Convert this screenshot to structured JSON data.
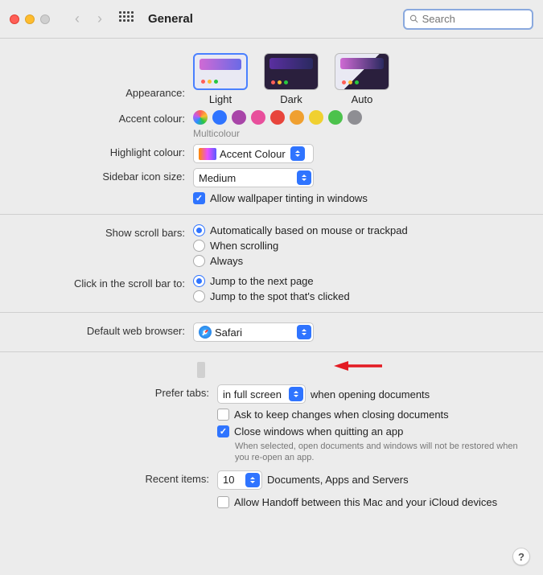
{
  "window": {
    "title": "General"
  },
  "search": {
    "placeholder": "Search"
  },
  "appearance": {
    "label": "Appearance:",
    "options": [
      "Light",
      "Dark",
      "Auto"
    ]
  },
  "accent": {
    "label": "Accent colour:",
    "selected_name": "Multicolour",
    "colors": [
      "multi",
      "#2f74ff",
      "#a845a8",
      "#e84f9c",
      "#e8453c",
      "#f0a030",
      "#f0d030",
      "#4cc24c",
      "#8e8e93"
    ]
  },
  "highlight": {
    "label": "Highlight colour:",
    "value": "Accent Colour"
  },
  "sidebar": {
    "label": "Sidebar icon size:",
    "value": "Medium"
  },
  "wallpaper_tint": {
    "label": "Allow wallpaper tinting in windows",
    "checked": true
  },
  "scrollbars": {
    "label": "Show scroll bars:",
    "options": [
      "Automatically based on mouse or trackpad",
      "When scrolling",
      "Always"
    ],
    "selected": 0
  },
  "click_scrollbar": {
    "label": "Click in the scroll bar to:",
    "options": [
      "Jump to the next page",
      "Jump to the spot that's clicked"
    ],
    "selected": 0
  },
  "default_browser": {
    "label": "Default web browser:",
    "value": "Safari"
  },
  "prefer_tabs": {
    "label": "Prefer tabs:",
    "value": "in full screen",
    "suffix": "when opening documents"
  },
  "ask_keep_changes": {
    "label": "Ask to keep changes when closing documents",
    "checked": false
  },
  "close_windows": {
    "label": "Close windows when quitting an app",
    "checked": true,
    "note": "When selected, open documents and windows will not be restored when you re-open an app."
  },
  "recent_items": {
    "label": "Recent items:",
    "value": "10",
    "suffix": "Documents, Apps and Servers"
  },
  "handoff": {
    "label": "Allow Handoff between this Mac and your iCloud devices",
    "checked": false
  },
  "help": "?"
}
